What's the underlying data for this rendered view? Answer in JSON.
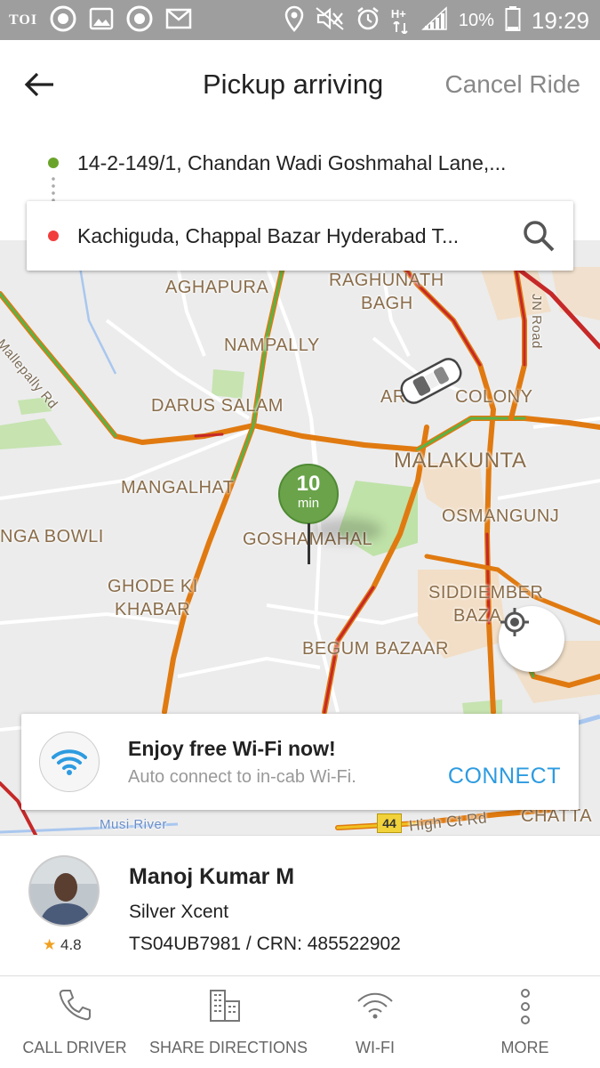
{
  "status_bar": {
    "left_app_label": "TOI",
    "left_icons": [
      "notification-circle-icon",
      "image-icon",
      "notification-circle-icon",
      "mail-icon"
    ],
    "right_icons": [
      "location-icon",
      "mute-icon",
      "alarm-icon",
      "network-hplus-icon",
      "signal-icon",
      "battery-icon"
    ],
    "network_label": "H+",
    "battery": "10%",
    "time": "19:29"
  },
  "header": {
    "title": "Pickup arriving",
    "cancel_label": "Cancel Ride"
  },
  "route": {
    "pickup": "14-2-149/1, Chandan Wadi Goshmahal Lane,...",
    "drop": "Kachiguda, Chappal Bazar Hyderabad T..."
  },
  "map": {
    "labels": {
      "aghapura": "AGHAPURA",
      "raghunath1": "RAGHUNATH",
      "raghunath2": "BAGH",
      "nampally": "NAMPALLY",
      "mallepally": "Mallepally Rd",
      "darus": "DARUS SALAM",
      "colony1": "AR",
      "colony2": "COLONY",
      "malakunta": "MALAKUNTA",
      "mangalhat": "MANGALHAT",
      "osmangunj": "OSMANGUNJ",
      "ngabowli": "NGA BOWLI",
      "goshamahal": "GOSHAMAHAL",
      "ghode1": "GHODE KI",
      "ghode2": "KHABAR",
      "siddiamber1": "SIDDIEMBER",
      "siddiamber2": "BAZA",
      "begum": "BEGUM BAZAAR",
      "jnroad": "JN Road",
      "musi": "Musi River",
      "route44": "44",
      "highct": "High Ct Rd",
      "chatta": "CHATTA"
    },
    "eta_value": "10",
    "eta_unit": "min"
  },
  "wifi_card": {
    "title": "Enjoy free Wi-Fi now!",
    "subtitle": "Auto connect to in-cab Wi-Fi.",
    "action": "CONNECT"
  },
  "driver": {
    "name": "Manoj Kumar M",
    "car": "Silver Xcent",
    "registration": "TS04UB7981 / CRN: 485522902",
    "rating": "4.8"
  },
  "bottom_nav": [
    {
      "label": "CALL DRIVER",
      "icon": "phone-icon"
    },
    {
      "label": "SHARE DIRECTIONS",
      "icon": "buildings-icon"
    },
    {
      "label": "WI-FI",
      "icon": "wifi-icon"
    },
    {
      "label": "MORE",
      "icon": "more-vertical-icon"
    }
  ],
  "colors": {
    "status_bar_bg": "#9e9e9e",
    "pickup_dot": "#6aa32a",
    "drop_dot": "#f23d3d",
    "eta_pin": "#6aa34a",
    "accent_connect": "#2d9be0",
    "map_road_orange": "#e07a10",
    "map_traffic_green": "#58b348",
    "map_traffic_red": "#c62828"
  }
}
